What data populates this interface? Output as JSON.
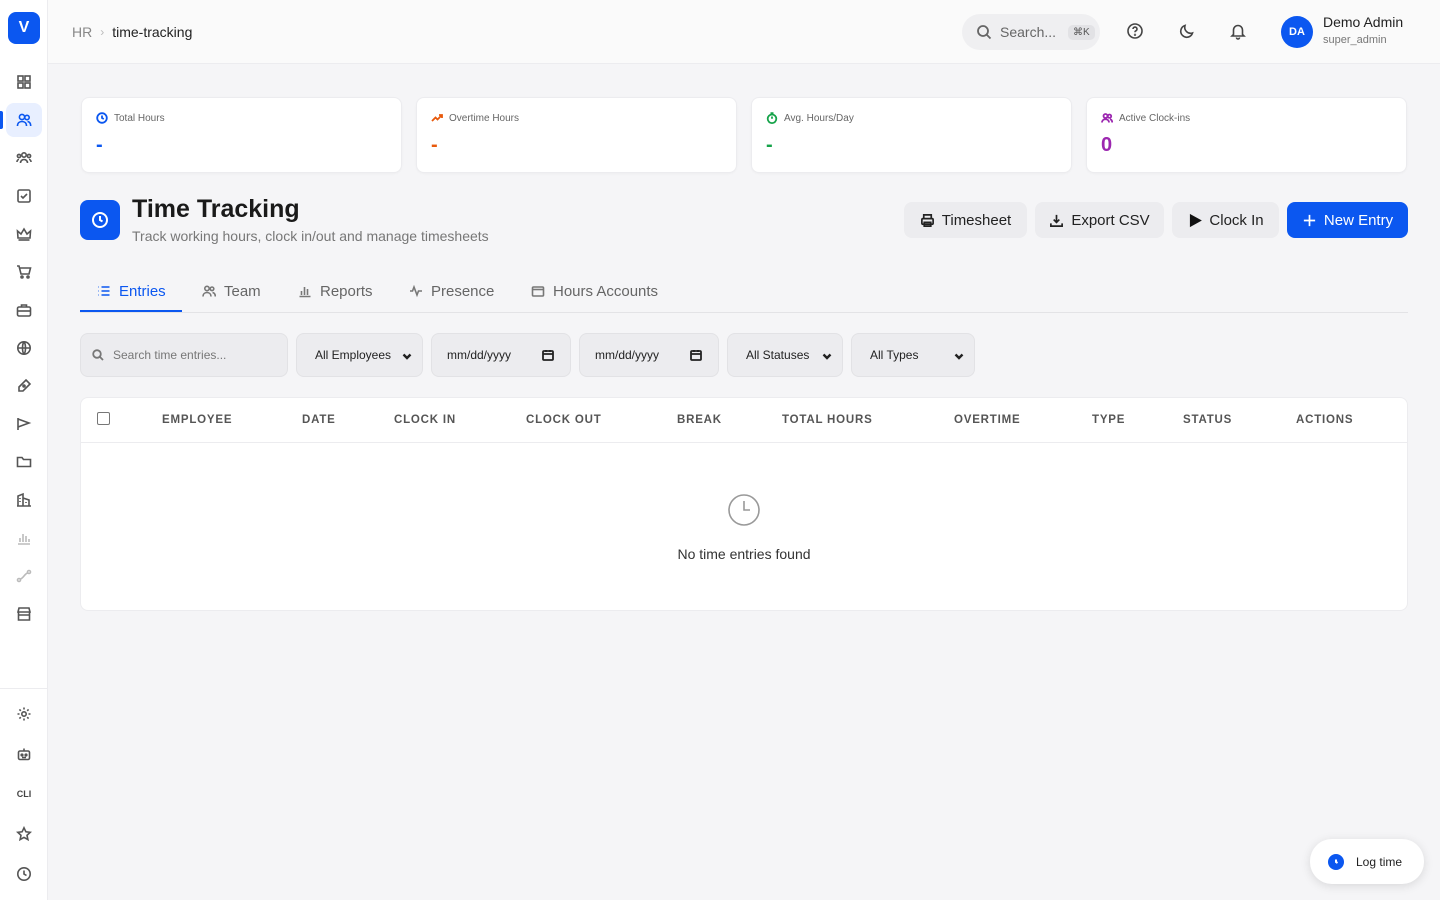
{
  "app": {
    "logo_letter": "V",
    "brand_color": "#0b57f0"
  },
  "sidebar": {
    "items": [
      {
        "name": "dashboard",
        "icon": "grid-icon"
      },
      {
        "name": "hr",
        "icon": "users-icon",
        "active": true
      },
      {
        "name": "team",
        "icon": "team-icon"
      },
      {
        "name": "tasks",
        "icon": "checkbox-icon"
      },
      {
        "name": "crown",
        "icon": "crown-icon"
      },
      {
        "name": "shop",
        "icon": "cart-icon"
      },
      {
        "name": "work",
        "icon": "briefcase-icon"
      },
      {
        "name": "globe",
        "icon": "globe-icon"
      },
      {
        "name": "design",
        "icon": "pen-icon"
      },
      {
        "name": "campaigns",
        "icon": "flag-icon"
      },
      {
        "name": "files",
        "icon": "folder-icon"
      },
      {
        "name": "buildings",
        "icon": "building-icon"
      },
      {
        "name": "analytics",
        "icon": "chart-icon"
      },
      {
        "name": "routes",
        "icon": "route-icon"
      },
      {
        "name": "store",
        "icon": "store-icon"
      }
    ],
    "bottom": {
      "cli_label": "CLI"
    }
  },
  "header": {
    "breadcrumb": {
      "parent": "HR",
      "separator": "›",
      "current": "time-tracking"
    },
    "search": {
      "placeholder": "Search...",
      "shortcut": "⌘K"
    },
    "user": {
      "initials": "DA",
      "name": "Demo Admin",
      "role": "super_admin"
    }
  },
  "stats": [
    {
      "label": "Total Hours",
      "value": "-",
      "color": "#0b57f0",
      "icon": "clock-icon"
    },
    {
      "label": "Overtime Hours",
      "value": "-",
      "color": "#e8590c",
      "icon": "trending-up-icon"
    },
    {
      "label": "Avg. Hours/Day",
      "value": "-",
      "color": "#16a34a",
      "icon": "timer-icon"
    },
    {
      "label": "Active Clock-ins",
      "value": "0",
      "color": "#9c27b0",
      "icon": "users-icon"
    }
  ],
  "page": {
    "title": "Time Tracking",
    "subtitle": "Track working hours, clock in/out and manage timesheets"
  },
  "actions": {
    "timesheet": "Timesheet",
    "export_csv": "Export CSV",
    "clock_in": "Clock In",
    "new_entry": "New Entry"
  },
  "tabs": [
    {
      "label": "Entries",
      "active": true
    },
    {
      "label": "Team"
    },
    {
      "label": "Reports"
    },
    {
      "label": "Presence"
    },
    {
      "label": "Hours Accounts"
    }
  ],
  "filters": {
    "search_placeholder": "Search time entries...",
    "employees": "All Employees",
    "date_from": "mm/dd/yyyy",
    "date_to": "mm/dd/yyyy",
    "statuses": "All Statuses",
    "types": "All Types"
  },
  "table": {
    "columns": [
      "EMPLOYEE",
      "DATE",
      "CLOCK IN",
      "CLOCK OUT",
      "BREAK",
      "TOTAL HOURS",
      "OVERTIME",
      "TYPE",
      "STATUS",
      "ACTIONS"
    ],
    "rows": [],
    "empty_text": "No time entries found"
  },
  "log_time": {
    "label": "Log time"
  }
}
